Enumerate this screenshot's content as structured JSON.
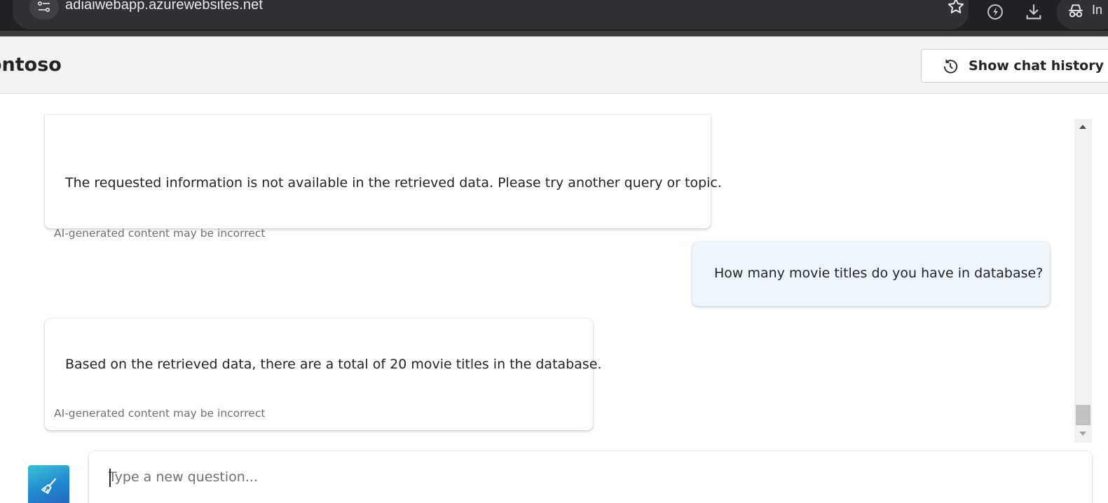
{
  "browser": {
    "url": "adiaiwebapp.azurewebsites.net",
    "profile_label": "In",
    "icons": [
      "site-info-icon",
      "star-icon",
      "performance-icon",
      "download-icon",
      "incognito-icon"
    ]
  },
  "header": {
    "app_title": "ontoso",
    "history_button_label": "Show chat history",
    "history_icon": "history-icon"
  },
  "chat": {
    "messages": [
      {
        "role": "assistant",
        "text": "The requested information is not available in the retrieved data. Please try another query or topic.",
        "disclaimer": "AI-generated content may be incorrect"
      },
      {
        "role": "user",
        "text": "How many movie titles do you have in database?"
      },
      {
        "role": "assistant",
        "text": "Based on the retrieved data, there are a total of 20 movie titles in the database.",
        "disclaimer": "AI-generated content may be incorrect"
      }
    ]
  },
  "composer": {
    "placeholder": "Type a new question...",
    "value": "",
    "clear_icon": "broom-icon",
    "accent_colors": [
      "#3cc0d6",
      "#1f86cf",
      "#2a5fc0"
    ]
  },
  "colors": {
    "user_bubble": "#edf5fd",
    "header_bg": "#f2f2f2",
    "browser_bg": "#202124"
  }
}
